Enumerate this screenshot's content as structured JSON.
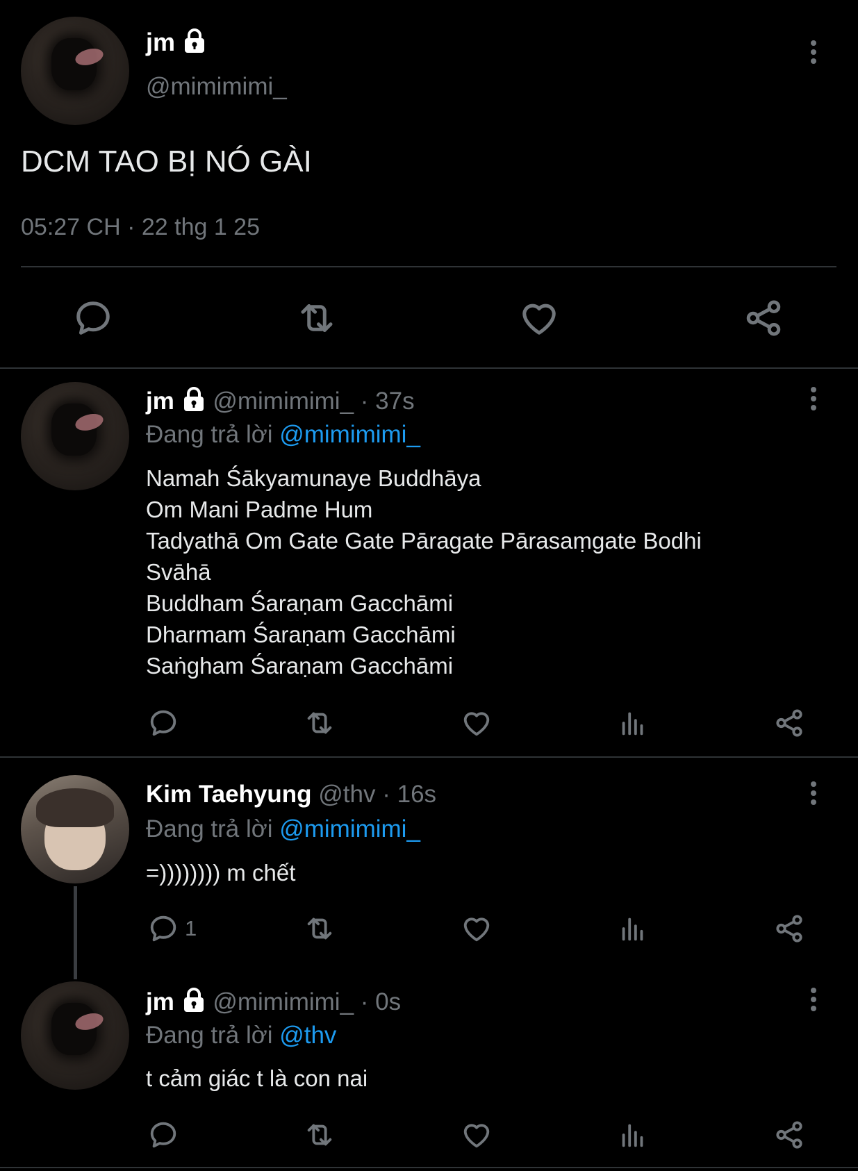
{
  "main_tweet": {
    "name": "jm",
    "handle": "@mimimimi_",
    "text": "DCM TAO BỊ NÓ GÀI",
    "timestamp": "05:27 CH · 22 thg 1 25"
  },
  "replies": [
    {
      "name": "jm",
      "handle": "@mimimimi_",
      "time": "· 37s",
      "replying_prefix": "Đang trả lời",
      "replying_to": "@mimimimi_",
      "lines": [
        "Namah Śākyamunaye Buddhāya",
        "Om Mani Padme Hum",
        "Tadyathā Om Gate Gate Pāragate Pārasaṃgate Bodhi",
        "Svāhā",
        "Buddham Śaraṇam Gacchāmi",
        "Dharmam Śaraṇam Gacchāmi",
        "Saṅgham Śaraṇam Gacchāmi"
      ]
    },
    {
      "name": "Kim Taehyung",
      "handle": "@thv",
      "time": "· 16s",
      "replying_prefix": "Đang trả lời",
      "replying_to": "@mimimimi_",
      "text": "=)))))))) m chết",
      "reply_count": "1"
    },
    {
      "name": "jm",
      "handle": "@mimimimi_",
      "time": "· 0s",
      "replying_prefix": "Đang trả lời",
      "replying_to": "@thv",
      "text": "t cảm giác t là con nai"
    }
  ],
  "icons": {
    "reply": "reply-icon",
    "retweet": "retweet-icon",
    "like": "heart-icon",
    "views": "analytics-icon",
    "share": "share-icon",
    "lock": "lock-icon",
    "more": "more-icon"
  },
  "colors": {
    "background": "#000000",
    "accent": "#1d9bf0",
    "muted": "#71767b"
  }
}
